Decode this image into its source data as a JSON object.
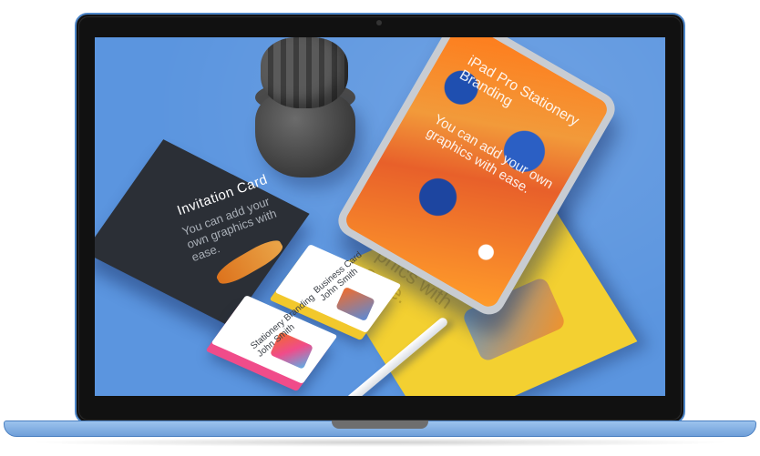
{
  "laptop": {
    "frame_color": "#4e86c8",
    "bezel_color": "#111111",
    "base_color": "#8fb8e8"
  },
  "scene": {
    "background_color": "#5b95df",
    "tablet": {
      "lines_top": "iPad Pro Stationery Branding",
      "lines_body": "You can add your own graphics with ease."
    },
    "invitation_card": {
      "title": "Invitation Card",
      "body": "You can add your own graphics with ease."
    },
    "poster": {
      "body": "own gra-phics with ease."
    },
    "business_card": {
      "title": "Business Card",
      "name": "John Smith"
    },
    "stationery_card": {
      "title": "Stationery Branding",
      "name": "John Smith"
    }
  }
}
